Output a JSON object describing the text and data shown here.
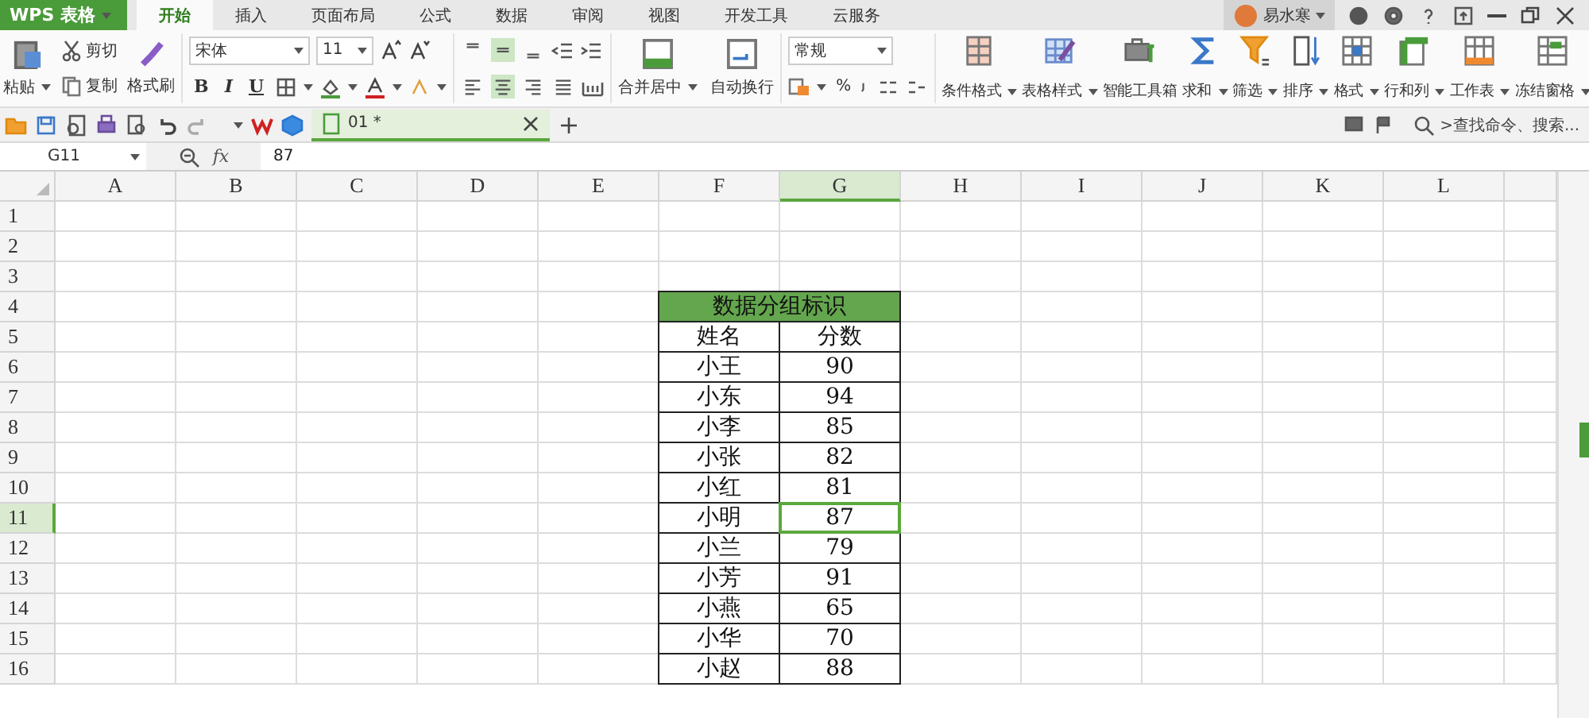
{
  "app_menu": "WPS 表格",
  "tabs": [
    {
      "label": "开始",
      "selected": true
    },
    {
      "label": "插入",
      "selected": false
    },
    {
      "label": "页面布局",
      "selected": false
    },
    {
      "label": "公式",
      "selected": false
    },
    {
      "label": "数据",
      "selected": false
    },
    {
      "label": "审阅",
      "selected": false
    },
    {
      "label": "视图",
      "selected": false
    },
    {
      "label": "开发工具",
      "selected": false
    },
    {
      "label": "云服务",
      "selected": false
    }
  ],
  "user": {
    "name": "易水寒"
  },
  "ribbon": {
    "clipboard": {
      "paste": "粘贴",
      "cut": "剪切",
      "copy": "复制",
      "format_painter": "格式刷"
    },
    "font": {
      "name": "宋体",
      "size": "11",
      "bold": "B",
      "italic": "I",
      "underline": "U"
    },
    "vertical_align": [
      {
        "selected": false
      },
      {
        "selected": true
      },
      {
        "selected": false
      }
    ],
    "horizontal_align": [
      {
        "selected": false
      },
      {
        "selected": true
      },
      {
        "selected": false
      },
      {
        "selected": false
      }
    ],
    "merge": "合并居中",
    "wrap": "自动换行",
    "number": {
      "format": "常规",
      "percent": "%"
    },
    "big_buttons": [
      {
        "label": "条件格式",
        "dropdown": true
      },
      {
        "label": "表格样式",
        "dropdown": true
      },
      {
        "label": "智能工具箱",
        "dropdown": false
      },
      {
        "label": "求和",
        "dropdown": true
      },
      {
        "label": "筛选",
        "dropdown": true
      },
      {
        "label": "排序",
        "dropdown": true
      },
      {
        "label": "格式",
        "dropdown": true
      },
      {
        "label": "行和列",
        "dropdown": true
      },
      {
        "label": "工作表",
        "dropdown": true
      },
      {
        "label": "冻结窗格",
        "dropdown": true
      }
    ]
  },
  "document_tab": {
    "label": "01 *"
  },
  "search": {
    "placeholder": ">查找命令、搜索..."
  },
  "formula_bar": {
    "name_box": "G11",
    "fx": "fx",
    "value": "87"
  },
  "sheet": {
    "columns": [
      {
        "label": "A",
        "selected": false
      },
      {
        "label": "B",
        "selected": false
      },
      {
        "label": "C",
        "selected": false
      },
      {
        "label": "D",
        "selected": false
      },
      {
        "label": "E",
        "selected": false
      },
      {
        "label": "F",
        "selected": false
      },
      {
        "label": "G",
        "selected": true
      },
      {
        "label": "H",
        "selected": false
      },
      {
        "label": "I",
        "selected": false
      },
      {
        "label": "J",
        "selected": false
      },
      {
        "label": "K",
        "selected": false
      },
      {
        "label": "L",
        "selected": false
      }
    ],
    "rows": [
      {
        "label": "1",
        "selected": false
      },
      {
        "label": "2",
        "selected": false
      },
      {
        "label": "3",
        "selected": false
      },
      {
        "label": "4",
        "selected": false
      },
      {
        "label": "5",
        "selected": false
      },
      {
        "label": "6",
        "selected": false
      },
      {
        "label": "7",
        "selected": false
      },
      {
        "label": "8",
        "selected": false
      },
      {
        "label": "9",
        "selected": false
      },
      {
        "label": "10",
        "selected": false
      },
      {
        "label": "11",
        "selected": true
      },
      {
        "label": "12",
        "selected": false
      },
      {
        "label": "13",
        "selected": false
      },
      {
        "label": "14",
        "selected": false
      },
      {
        "label": "15",
        "selected": false
      },
      {
        "label": "16",
        "selected": false
      }
    ],
    "table": {
      "title": "数据分组标识",
      "header": [
        "姓名",
        "分数"
      ],
      "records": [
        {
          "name": "小王",
          "score": "90",
          "selected": false
        },
        {
          "name": "小东",
          "score": "94",
          "selected": false
        },
        {
          "name": "小李",
          "score": "85",
          "selected": false
        },
        {
          "name": "小张",
          "score": "82",
          "selected": false
        },
        {
          "name": "小红",
          "score": "81",
          "selected": false
        },
        {
          "name": "小明",
          "score": "87",
          "selected": true
        },
        {
          "name": "小兰",
          "score": "79",
          "selected": false
        },
        {
          "name": "小芳",
          "score": "91",
          "selected": false
        },
        {
          "name": "小燕",
          "score": "65",
          "selected": false
        },
        {
          "name": "小华",
          "score": "70",
          "selected": false
        },
        {
          "name": "小赵",
          "score": "88",
          "selected": false
        }
      ]
    }
  }
}
